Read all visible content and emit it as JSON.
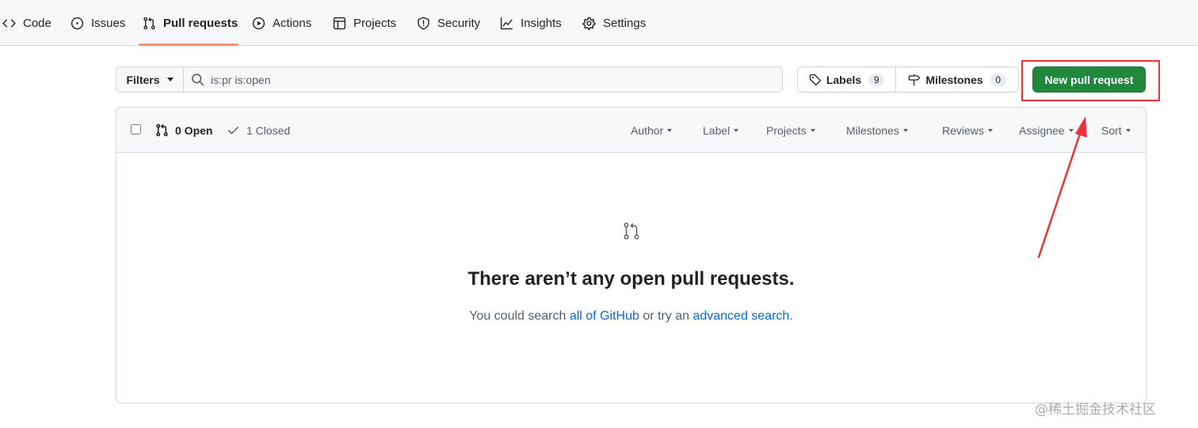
{
  "repo_nav": {
    "items": [
      {
        "label": "Code",
        "icon": "code-icon"
      },
      {
        "label": "Issues",
        "icon": "issue-opened-icon"
      },
      {
        "label": "Pull requests",
        "icon": "git-pull-request-icon"
      },
      {
        "label": "Actions",
        "icon": "play-icon"
      },
      {
        "label": "Projects",
        "icon": "table-icon"
      },
      {
        "label": "Security",
        "icon": "shield-icon"
      },
      {
        "label": "Insights",
        "icon": "graph-icon"
      },
      {
        "label": "Settings",
        "icon": "gear-icon"
      }
    ],
    "selected": "Pull requests"
  },
  "subnav": {
    "filters_label": "Filters",
    "search_value": "is:pr is:open",
    "labels_label": "Labels",
    "labels_count": "9",
    "milestones_label": "Milestones",
    "milestones_count": "0",
    "new_pr_label": "New pull request"
  },
  "list_header": {
    "open_label": "0 Open",
    "closed_label": "1 Closed",
    "dropdowns": [
      "Author",
      "Label",
      "Projects",
      "Milestones",
      "Reviews",
      "Assignee",
      "Sort"
    ]
  },
  "blankslate": {
    "title": "There aren’t any open pull requests.",
    "text_before": "You could search ",
    "link1": "all of GitHub",
    "text_middle": " or try an ",
    "link2": "advanced search",
    "text_after": "."
  },
  "annotation": {
    "color": "#e8323c"
  },
  "colors": {
    "primary_button": "#1f883d",
    "link": "#0969da",
    "nav_underline": "#fd8c73"
  },
  "watermark": "@稀土掘金技术社区"
}
